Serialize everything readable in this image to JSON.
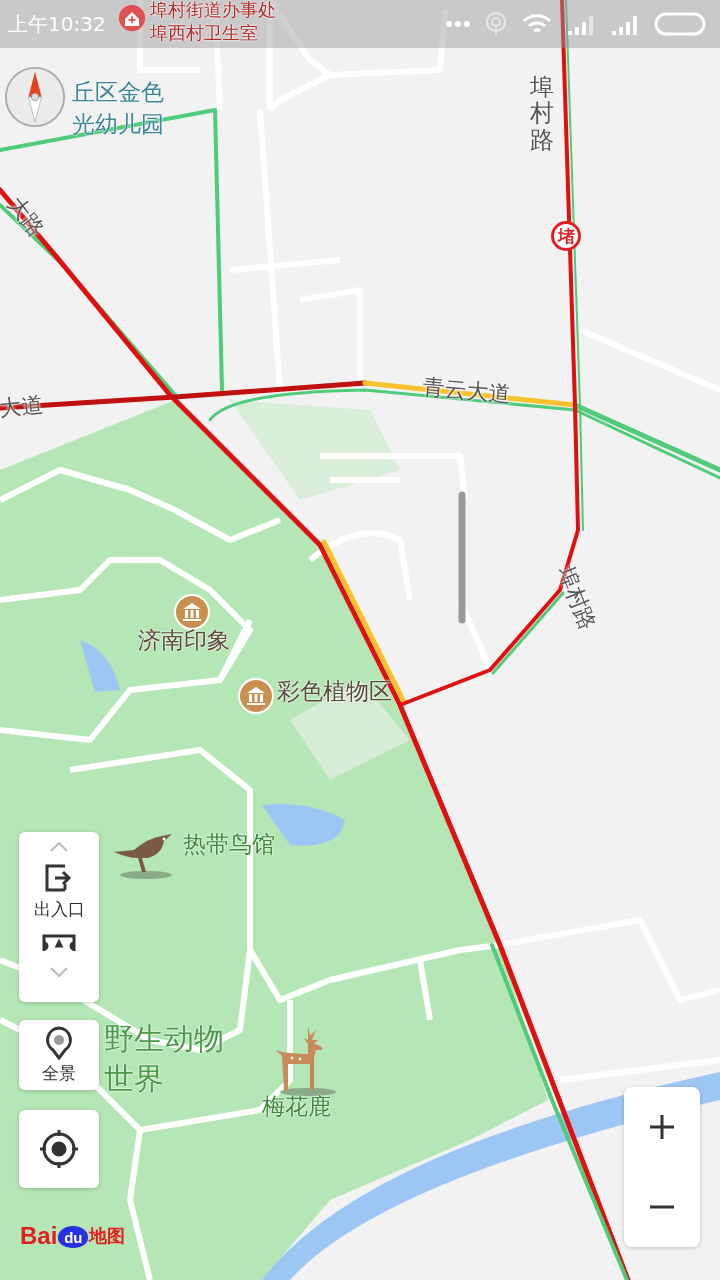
{
  "status_bar": {
    "time": "上午10:32"
  },
  "place_labels": [
    {
      "text": "埠村街道办事处",
      "kind": "poi"
    },
    {
      "text": "埠西村卫生室",
      "kind": "poi"
    },
    {
      "text": "丘区金色",
      "kind": "school"
    },
    {
      "text": "光幼儿园",
      "kind": "school"
    },
    {
      "text": "济南印象",
      "kind": "museum"
    },
    {
      "text": "彩色植物区",
      "kind": "museum"
    },
    {
      "text": "热带鸟馆",
      "kind": "bird"
    },
    {
      "text": "梅花鹿",
      "kind": "deer"
    },
    {
      "text": "野生动物",
      "kind": "park"
    },
    {
      "text": "世界",
      "kind": "park"
    }
  ],
  "road_labels": [
    {
      "text": "埠村路",
      "kind": "vertical"
    },
    {
      "text": "青云大道",
      "kind": "angled"
    },
    {
      "text": "大道",
      "kind": "angled"
    },
    {
      "text": "大路",
      "kind": "angled"
    },
    {
      "text": "埠村路",
      "kind": "angled"
    }
  ],
  "traffic_badge": "堵",
  "side_panel": {
    "items": [
      {
        "kind": "entrance",
        "label": "出入口"
      },
      {
        "kind": "ticket"
      }
    ]
  },
  "panorama": {
    "label": "全景"
  },
  "logo": {
    "parts": [
      "Bai",
      "du",
      "地图"
    ]
  }
}
